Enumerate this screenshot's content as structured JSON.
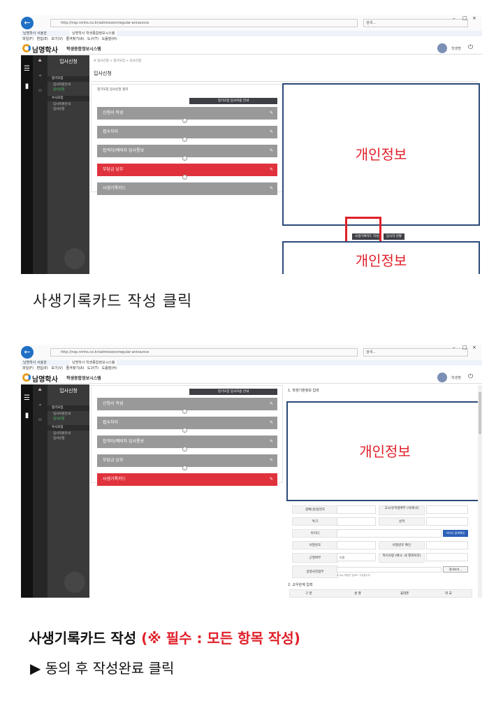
{
  "browser": {
    "url": "http://nsp.nmhs.co.kr/admission/regular-announce",
    "search_placeholder": "검색...",
    "tab1": "남명학사 서울관",
    "tab2": "남명학사 학생종합정보시스템",
    "menu": "파일(F)  편집(E)  보기(V)  즐겨찾기(A)  도구(T)  도움말(H)"
  },
  "app": {
    "logo": "남명학사",
    "system_name": "학생종합정보시스템",
    "user": "학생명",
    "section": "입사신청",
    "breadcrumb": "※ 입사신청 > 정기모집 > 입사신청",
    "page_title": "입사신청",
    "rail_items": [
      "입사신청",
      "학생생활기록",
      "생활관안내"
    ]
  },
  "sidebar": {
    "groups": [
      {
        "label": "정기모집",
        "items": [
          "입사지원안내",
          "입사신청"
        ],
        "active": 1
      },
      {
        "label": "수시모집",
        "items": [
          "입사지원안내",
          "입사신청"
        ],
        "active": -1
      }
    ]
  },
  "panel1": {
    "heading": "정기모집 입사신청 절차",
    "guide_button": "정기모집 입사자용 안내",
    "steps": [
      "신청서 작성",
      "접수처리",
      "합격자/예비자 입사통보",
      "부담금 납부",
      "사생기록카드"
    ],
    "active_step": 3,
    "write_card_button": "사생기록카드 작성",
    "status_button": "입사자 현황"
  },
  "panel2": {
    "guide_button": "정기모집 입사자용 안내",
    "steps": [
      "신청서 작성",
      "접수처리",
      "합격자/예비자 입사통보",
      "부담금 납부",
      "사생기록카드"
    ],
    "active_step": 4,
    "form_section1": "1. 학생기본정보 입력",
    "form_section2": "2. 교우관계 입력",
    "fields": {
      "r1l": "생체(성)등번호",
      "r1r": "고시/유학생여부 (석/박사)",
      "r2l": "특기",
      "r2r": "성격",
      "r3l": "아이디",
      "r3btn": "아이디 중복확인",
      "r4l": "비밀번호",
      "r4r": "비밀번호 확인",
      "r5l": "군필여부",
      "r5val": "미필",
      "r5r": "특이사항 (예시: 내 행복처리)",
      "r6l": "증명사진첨부",
      "r6btn": "찾아보기...",
      "r6note": "※ jpg 파일만 업로드 가능합니다",
      "t1": "구 분",
      "t2": "성 명",
      "t3": "휴대폰",
      "t4": "학 교"
    }
  },
  "redaction_label": "개인정보",
  "captions": {
    "step1": "사생기록카드 작성 클릭",
    "step2_main": "사생기록카드 작성 ",
    "step2_note": "(※ 필수 : 모든 항목 작성)",
    "step2_sub": "▶ 동의 후 작성완료 클릭"
  },
  "colors": {
    "accent_red": "#e0323c",
    "step_gray": "#999999",
    "redact_border": "#2b4a78"
  }
}
